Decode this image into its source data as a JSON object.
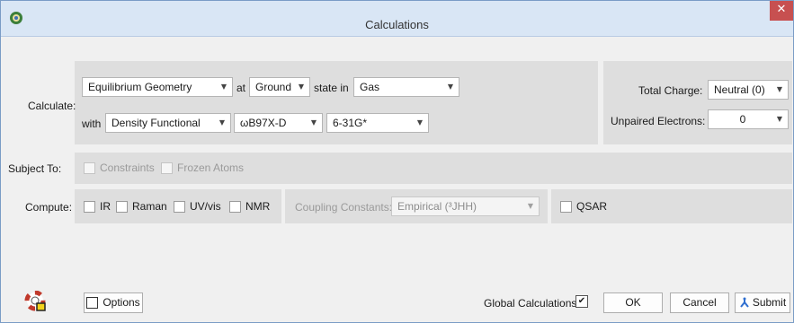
{
  "window": {
    "title": "Calculations",
    "close_glyph": "✕"
  },
  "calculate": {
    "label": "Calculate:",
    "method": "Equilibrium Geometry",
    "at_label": "at",
    "state": "Ground",
    "state_in_label": "state in",
    "medium": "Gas",
    "with_label": "with",
    "theory": "Density Functional",
    "functional": "ωB97X-D",
    "basis_set": "6-31G*"
  },
  "charge": {
    "total_charge_label": "Total Charge:",
    "total_charge_value": "Neutral (0)",
    "unpaired_label": "Unpaired Electrons:",
    "unpaired_value": "0"
  },
  "subject_to": {
    "label": "Subject To:",
    "constraints": "Constraints",
    "frozen_atoms": "Frozen Atoms"
  },
  "compute": {
    "label": "Compute:",
    "ir": "IR",
    "raman": "Raman",
    "uvvis": "UV/vis",
    "nmr": "NMR",
    "coupling_label": "Coupling Constants:",
    "coupling_value": "Empirical (³JHH)",
    "qsar": "QSAR"
  },
  "footer": {
    "options_label": "Options",
    "global_calculations_label": "Global Calculations",
    "global_calculations_checked": true,
    "check_glyph": "✔",
    "ok_label": "OK",
    "cancel_label": "Cancel",
    "submit_label": "Submit"
  },
  "colors": {
    "titlebar": "#d9e6f5",
    "close_button": "#c75050",
    "panel": "#dedede",
    "window_background": "#f0f0f0"
  },
  "icons": [
    "app-icon",
    "close-icon",
    "chevron-down-icon",
    "help-lifebuoy-icon",
    "submit-icon"
  ]
}
